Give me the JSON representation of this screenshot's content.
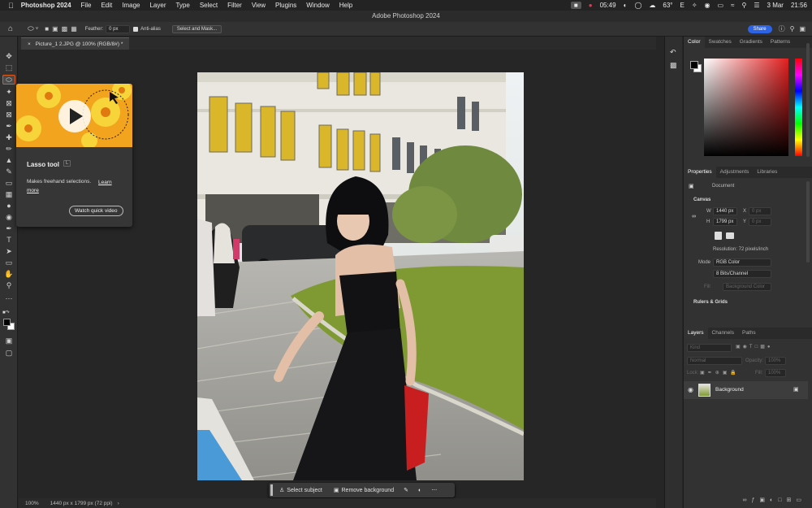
{
  "menubar": {
    "app": "Photoshop 2024",
    "items": [
      "File",
      "Edit",
      "Image",
      "Layer",
      "Type",
      "Select",
      "Filter",
      "View",
      "Plugins",
      "Window",
      "Help"
    ],
    "time": "05:49",
    "temp": "63°",
    "lang": "E",
    "date": "3 Mar",
    "clock": "21:56"
  },
  "window": {
    "title": "Adobe Photoshop 2024"
  },
  "options": {
    "feather_label": "Feather:",
    "feather_value": "0 px",
    "antialias_label": "Anti-alias",
    "select_mask": "Select and Mask...",
    "share": "Share"
  },
  "document": {
    "tab": "Picture_1 2.JPG @ 100% (RGB/8#) *"
  },
  "tooltip": {
    "title": "Lasso tool",
    "shortcut": "L",
    "desc": "Makes freehand selections.",
    "learn": "Learn more",
    "watch": "Watch quick video"
  },
  "taskbar": {
    "select_subject": "Select subject",
    "remove_bg": "Remove background"
  },
  "status": {
    "zoom": "100%",
    "info": "1440 px x 1799 px (72 ppi)"
  },
  "color_panel": {
    "tabs": [
      "Color",
      "Swatches",
      "Gradients",
      "Patterns"
    ]
  },
  "properties": {
    "tabs": [
      "Properties",
      "Adjustments",
      "Libraries"
    ],
    "doc_label": "Document",
    "canvas_label": "Canvas",
    "w_label": "W",
    "w_value": "1440 px",
    "x_label": "X",
    "x_value": "0 px",
    "h_label": "H",
    "h_value": "1799 px",
    "y_label": "Y",
    "y_value": "0 px",
    "resolution": "Resolution: 72 pixels/inch",
    "mode_label": "Mode",
    "mode_value": "RGB Color",
    "bits_value": "8 Bits/Channel",
    "fill_label": "Fill",
    "fill_value": "Background Color",
    "rulers": "Rulers & Grids"
  },
  "layers": {
    "tabs": [
      "Layers",
      "Channels",
      "Paths"
    ],
    "kind": "Kind",
    "blend": "Normal",
    "opacity_label": "Opacity:",
    "opacity_value": "100%",
    "lock_label": "Lock:",
    "fill_label": "Fill:",
    "fill_value": "100%",
    "layer_name": "Background"
  },
  "colors": {
    "accent": "#e05a1c",
    "share": "#2d64e6",
    "panel": "#323232"
  }
}
